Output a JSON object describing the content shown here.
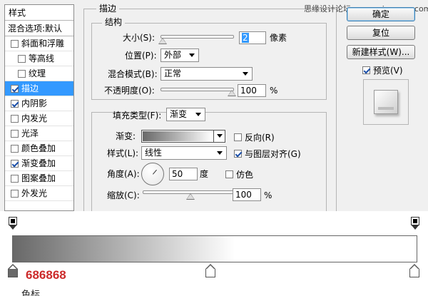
{
  "styles_panel": {
    "header": "样式",
    "blend_options": "混合选项:默认",
    "items": [
      {
        "label": "斜面和浮雕",
        "checked": false
      },
      {
        "label": "等高线",
        "checked": false
      },
      {
        "label": "纹理",
        "checked": false
      },
      {
        "label": "描边",
        "checked": true,
        "selected": true
      },
      {
        "label": "内阴影",
        "checked": true
      },
      {
        "label": "内发光",
        "checked": false
      },
      {
        "label": "光泽",
        "checked": false
      },
      {
        "label": "颜色叠加",
        "checked": false
      },
      {
        "label": "渐变叠加",
        "checked": true
      },
      {
        "label": "图案叠加",
        "checked": false
      },
      {
        "label": "外发光",
        "checked": false
      }
    ]
  },
  "stroke": {
    "title": "描边",
    "structure": {
      "title": "结构",
      "size_label": "大小(S):",
      "size_value": "2",
      "size_unit": "像素",
      "size_slider": 0.02,
      "position_label": "位置(P):",
      "position_value": "外部",
      "blend_label": "混合模式(B):",
      "blend_value": "正常",
      "opacity_label": "不透明度(O):",
      "opacity_value": "100",
      "opacity_unit": "%",
      "opacity_slider": 1.0
    },
    "fill": {
      "type_label": "填充类型(F):",
      "type_value": "渐变",
      "gradient_label": "渐变:",
      "reverse_label": "反向(R)",
      "reverse_checked": false,
      "style_label": "样式(L):",
      "style_value": "线性",
      "align_label": "与图层对齐(G)",
      "align_checked": true,
      "angle_label": "角度(A):",
      "angle_value": "50",
      "angle_unit": "度",
      "dither_label": "仿色",
      "dither_checked": false,
      "scale_label": "缩放(C):",
      "scale_value": "100",
      "scale_unit": "%",
      "scale_slider": 0.5
    }
  },
  "buttons": {
    "ok": "确定",
    "reset": "复位",
    "new_style": "新建样式(W)...",
    "preview_label": "预览(V)",
    "preview_checked": true
  },
  "watermark": "思缘设计论坛 www.missyuan.com",
  "gradient_editor": {
    "start_color": "#686868",
    "end_color": "#ffffff",
    "color_value": "686868",
    "caption": "色标"
  }
}
